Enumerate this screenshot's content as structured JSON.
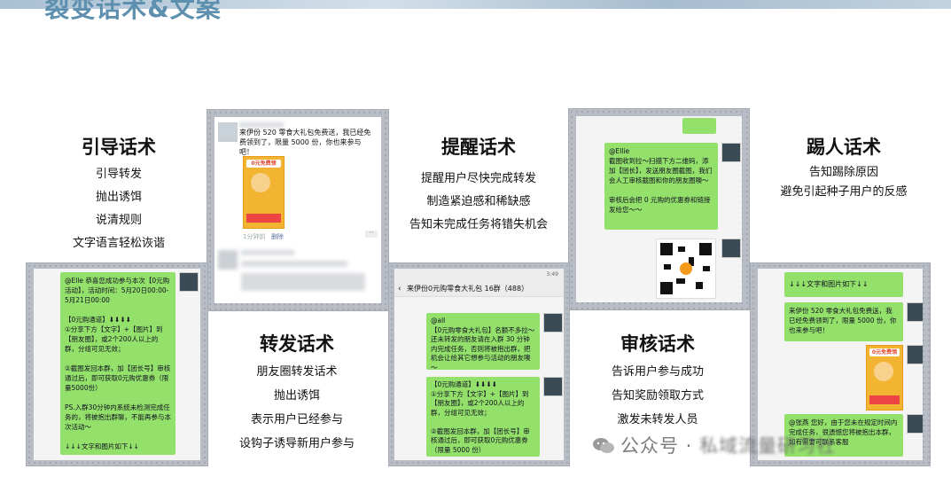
{
  "title": "裂变话术&文案",
  "sections": {
    "guide": {
      "heading": "引导话术",
      "lines": [
        "引导转发",
        "抛出诱饵",
        "说清规则",
        "文字语言轻松诙谐"
      ]
    },
    "remind": {
      "heading": "提醒话术",
      "lines": [
        "提醒用户尽快完成转发",
        "制造紧迫感和稀缺感",
        "告知未完成任务将错失机会"
      ]
    },
    "kick": {
      "heading": "踢人话术",
      "lines": [
        "告知踢除原因",
        "避免引起种子用户的反感"
      ]
    },
    "forward": {
      "heading": "转发话术",
      "lines": [
        "朋友圈转发话术",
        "抛出诱饵",
        "表示用户已经参与",
        "设钩子诱导新用户参与"
      ]
    },
    "review": {
      "heading": "审核话术",
      "lines": [
        "告诉用户参与成功",
        "告知奖励领取方式",
        "激发未转发人员"
      ]
    }
  },
  "shots": {
    "moments": {
      "text": "来伊份 520 零食大礼包免费送，我已经免费领到了，限量 5000 份，你也来参与吧！",
      "poster_tag": "0元免费领",
      "time": "1分钟前",
      "delete": "删除"
    },
    "review_chat": {
      "text": "@Ellie\n截图收到拉～扫描下方二维码，添加【团长】，发送朋友圈截图，我们会人工审核截图和你的朋友圈噢～\n\n审核后会把 0 元购的优惠券和链接发给您～～"
    },
    "guide_chat": {
      "text": "@Elle 恭喜您成功参与本次【0元购活动】，活动时间：5月20日00:00-5月21日00:00\n\n【0元购通道】⬇⬇⬇⬇\n①分享下方【文字】+【图片】到【朋友圈】，或2个200人以上的群，分组可见无效；\n\n②截图发回本群，加【团长号】审核通过后，即可获取0元购优惠券（限量5000份）\n\nPS.入群30分钟内系统未检测完成任务的，将被抱出群聊，不能再参与本次活动～\n\n↓↓↓文字和图片如下↓↓"
    },
    "remind_chat": {
      "status_time": "3:49",
      "title": "来伊份0元购零食大礼包 16群（488）",
      "msg1": "@all\n【0元购零食大礼包】名额不多拉～还未转发的朋友请在入群 30 分钟内完成任务，否则将被抱出群，把机会让给其它想参与活动的朋友噢～",
      "msg2": "【0元购通道】⬇⬇⬇⬇\n①分享下方【文字】+【图片】到【朋友圈】，或2个200人以上的群，分组可见无效；\n\n②截图发回本群，加【团长号】审核通过后，即可获取0元购优惠券（限量 5000 份）"
    },
    "kick_chat": {
      "msg1": "↓↓↓文字和图片如下↓↓",
      "msg2": "来伊份 520 零食大礼包免费送，我已经免费领到了，限量 5000 份，你也来参与吧！",
      "poster_tag": "0元免费领",
      "msg3": "@张燕 您好，由于您未在规定时间内完成任务，很遗憾您将被抱出本群，如有需要可联系客服"
    }
  },
  "watermark": {
    "prefix": "公众号 · ",
    "name": "私域流量研习社"
  }
}
